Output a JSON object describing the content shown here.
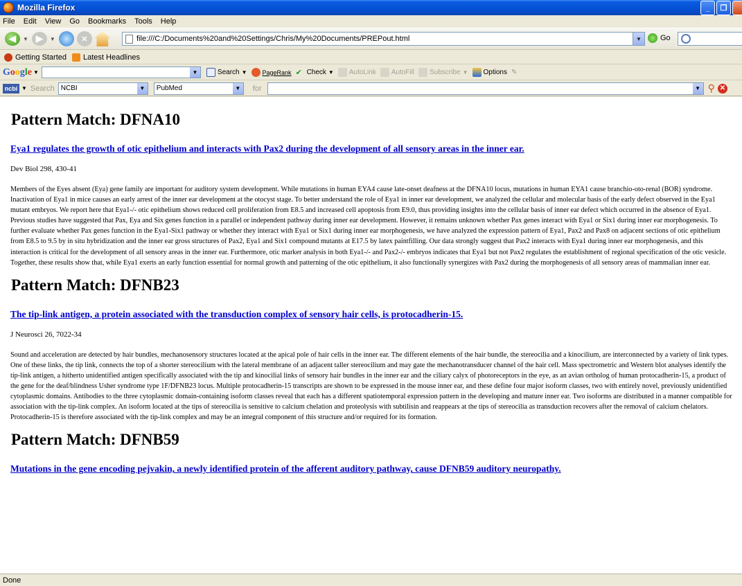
{
  "window": {
    "title": "Mozilla Firefox"
  },
  "menu": [
    "File",
    "Edit",
    "View",
    "Go",
    "Bookmarks",
    "Tools",
    "Help"
  ],
  "navbar": {
    "url": "file:///C:/Documents%20and%20Settings/Chris/My%20Documents/PREPout.html",
    "go_label": "Go"
  },
  "bookmarks": [
    "Getting Started",
    "Latest Headlines"
  ],
  "google_toolbar": {
    "logo": [
      "G",
      "o",
      "o",
      "g",
      "l",
      "e"
    ],
    "search_label": "Search",
    "pagerank_label": "PageRank",
    "check_label": "Check",
    "autolink_label": "AutoLink",
    "autofill_label": "AutoFill",
    "subscribe_label": "Subscribe",
    "options_label": "Options"
  },
  "ncbi_toolbar": {
    "logo": "ncbi",
    "search_label": "Search",
    "db_select": "NCBI",
    "subdb_select": "PubMed",
    "for_label": "for"
  },
  "entries": [
    {
      "heading": "Pattern Match: DFNA10",
      "title": "Eya1 regulates the growth of otic epithelium and interacts with Pax2 during the development of all sensory areas in the inner ear.",
      "citation": "Dev Biol 298, 430-41",
      "abstract": "Members of the Eyes absent (Eya) gene family are important for auditory system development. While mutations in human EYA4 cause late-onset deafness at the DFNA10 locus, mutations in human EYA1 cause branchio-oto-renal (BOR) syndrome. Inactivation of Eya1 in mice causes an early arrest of the inner ear development at the otocyst stage. To better understand the role of Eya1 in inner ear development, we analyzed the cellular and molecular basis of the early defect observed in the Eya1 mutant embryos. We report here that Eya1-/- otic epithelium shows reduced cell proliferation from E8.5 and increased cell apoptosis from E9.0, thus providing insights into the cellular basis of inner ear defect which occurred in the absence of Eya1. Previous studies have suggested that Pax, Eya and Six genes function in a parallel or independent pathway during inner ear development. However, it remains unknown whether Pax genes interact with Eya1 or Six1 during inner ear morphogenesis. To further evaluate whether Pax genes function in the Eya1-Six1 pathway or whether they interact with Eya1 or Six1 during inner ear morphogenesis, we have analyzed the expression pattern of Eya1, Pax2 and Pax8 on adjacent sections of otic epithelium from E8.5 to 9.5 by in situ hybridization and the inner ear gross structures of Pax2, Eya1 and Six1 compound mutants at E17.5 by latex paintfilling. Our data strongly suggest that Pax2 interacts with Eya1 during inner ear morphogenesis, and this interaction is critical for the development of all sensory areas in the inner ear. Furthermore, otic marker analysis in both Eya1-/- and Pax2-/- embryos indicates that Eya1 but not Pax2 regulates the establishment of regional specification of the otic vesicle. Together, these results show that, while Eya1 exerts an early function essential for normal growth and patterning of the otic epithelium, it also functionally synergizes with Pax2 during the morphogenesis of all sensory areas of mammalian inner ear."
    },
    {
      "heading": "Pattern Match: DFNB23",
      "title": "The tip-link antigen, a protein associated with the transduction complex of sensory hair cells, is protocadherin-15.",
      "citation": "J Neurosci 26, 7022-34",
      "abstract": "Sound and acceleration are detected by hair bundles, mechanosensory structures located at the apical pole of hair cells in the inner ear. The different elements of the hair bundle, the stereocilia and a kinocilium, are interconnected by a variety of link types. One of these links, the tip link, connects the top of a shorter stereocilium with the lateral membrane of an adjacent taller stereocilium and may gate the mechanotransducer channel of the hair cell. Mass spectrometric and Western blot analyses identify the tip-link antigen, a hitherto unidentified antigen specifically associated with the tip and kinocilial links of sensory hair bundles in the inner ear and the ciliary calyx of photoreceptors in the eye, as an avian ortholog of human protocadherin-15, a product of the gene for the deaf/blindness Usher syndrome type 1F/DFNB23 locus. Multiple protocadherin-15 transcripts are shown to be expressed in the mouse inner ear, and these define four major isoform classes, two with entirely novel, previously unidentified cytoplasmic domains. Antibodies to the three cytoplasmic domain-containing isoform classes reveal that each has a different spatiotemporal expression pattern in the developing and mature inner ear. Two isoforms are distributed in a manner compatible for association with the tip-link complex. An isoform located at the tips of stereocilia is sensitive to calcium chelation and proteolysis with subtilisin and reappears at the tips of stereocilia as transduction recovers after the removal of calcium chelators. Protocadherin-15 is therefore associated with the tip-link complex and may be an integral component of this structure and/or required for its formation."
    },
    {
      "heading": "Pattern Match: DFNB59",
      "title": "Mutations in the gene encoding pejvakin, a newly identified protein of the afferent auditory pathway, cause DFNB59 auditory neuropathy.",
      "citation": "",
      "abstract": ""
    }
  ],
  "status": "Done"
}
